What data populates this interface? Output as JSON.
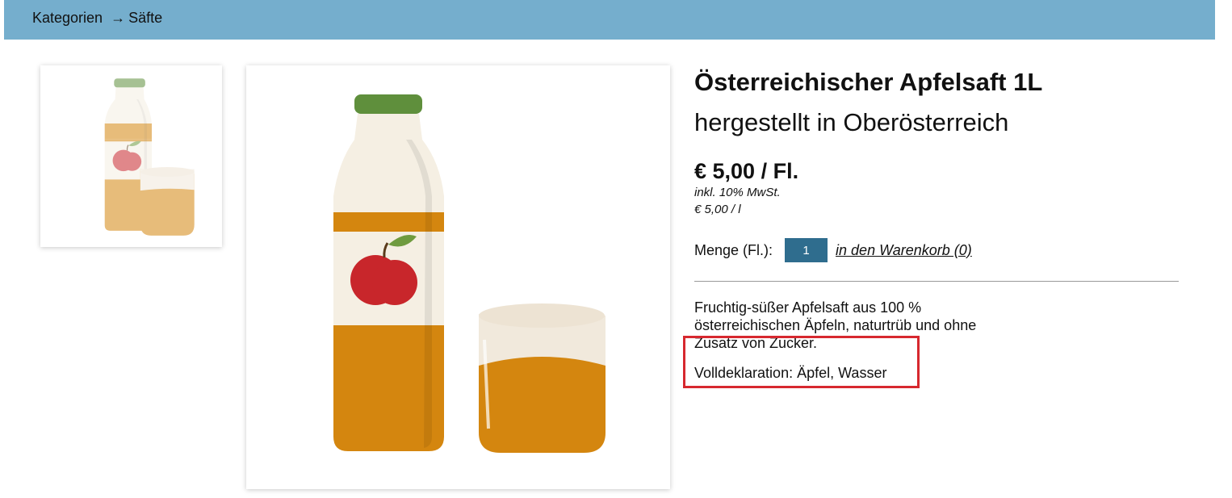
{
  "breadcrumb": {
    "category": "Kategorien",
    "arrow": "→",
    "current": "Säfte"
  },
  "images": {
    "thumbnail": {
      "icon": "juice-bottle-glass-illustration"
    },
    "main": {
      "icon": "juice-bottle-glass-illustration"
    }
  },
  "product": {
    "title": "Österreichischer Apfelsaft 1L",
    "subtitle": "hergestellt in Oberösterreich",
    "price": "€ 5,00 / Fl.",
    "tax_note": "inkl. 10% MwSt.",
    "unit_price": "€ 5,00 / l",
    "quantity_label": "Menge (Fl.):",
    "quantity_value": "1",
    "cart_link": "in den Warenkorb (0)",
    "description": "Fruchtig-süßer Apfelsaft aus 100 % österreichischen Äpfeln, naturtrüb und ohne Zusatz von Zucker.",
    "declaration": "Volldeklaration: Äpfel, Wasser"
  },
  "colors": {
    "topbar": "#75aecd",
    "quantity_input": "#2f6d8e",
    "highlight": "#d7282f",
    "juice": "#d4860f",
    "bottle_cap": "#5f8f3c",
    "apple": "#c8262b"
  }
}
